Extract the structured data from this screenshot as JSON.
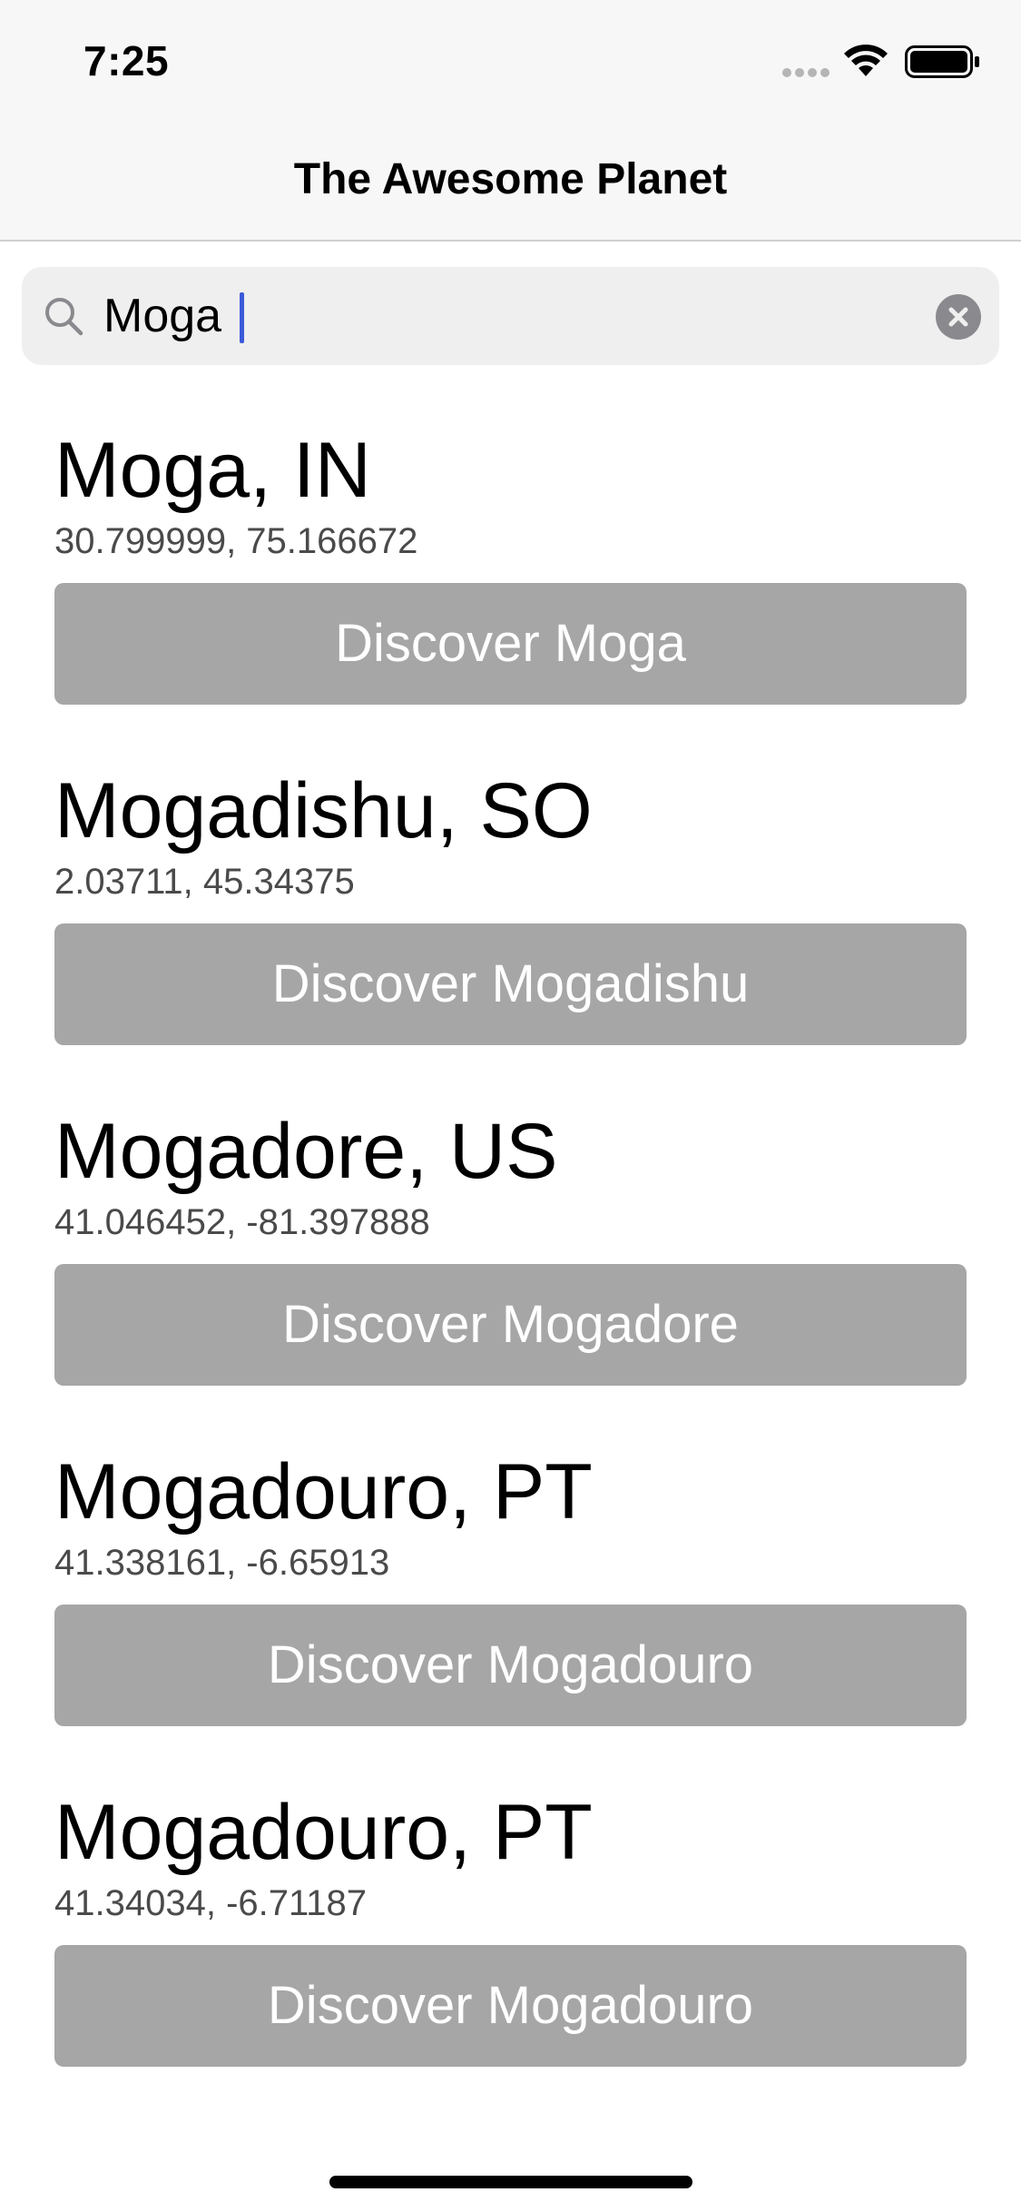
{
  "status_bar": {
    "time": "7:25",
    "icons": [
      "cellular-signal-icon",
      "wifi-icon",
      "battery-icon"
    ]
  },
  "nav": {
    "title": "The Awesome Planet"
  },
  "search": {
    "value": "Moga",
    "icon": "search-icon",
    "clear_icon": "clear-icon"
  },
  "results": [
    {
      "title": "Moga, IN",
      "coords": "30.799999, 75.166672",
      "button": "Discover Moga"
    },
    {
      "title": "Mogadishu, SO",
      "coords": "2.03711, 45.34375",
      "button": "Discover Mogadishu"
    },
    {
      "title": "Mogadore, US",
      "coords": "41.046452, -81.397888",
      "button": "Discover Mogadore"
    },
    {
      "title": "Mogadouro, PT",
      "coords": "41.338161, -6.65913",
      "button": "Discover Mogadouro"
    },
    {
      "title": "Mogadouro, PT",
      "coords": "41.34034, -6.71187",
      "button": "Discover Mogadouro"
    }
  ],
  "colors": {
    "button_bg": "#a6a6a6",
    "caret": "#3a5bd9",
    "nav_bg": "#f7f7f7",
    "search_bg": "#efefef"
  }
}
